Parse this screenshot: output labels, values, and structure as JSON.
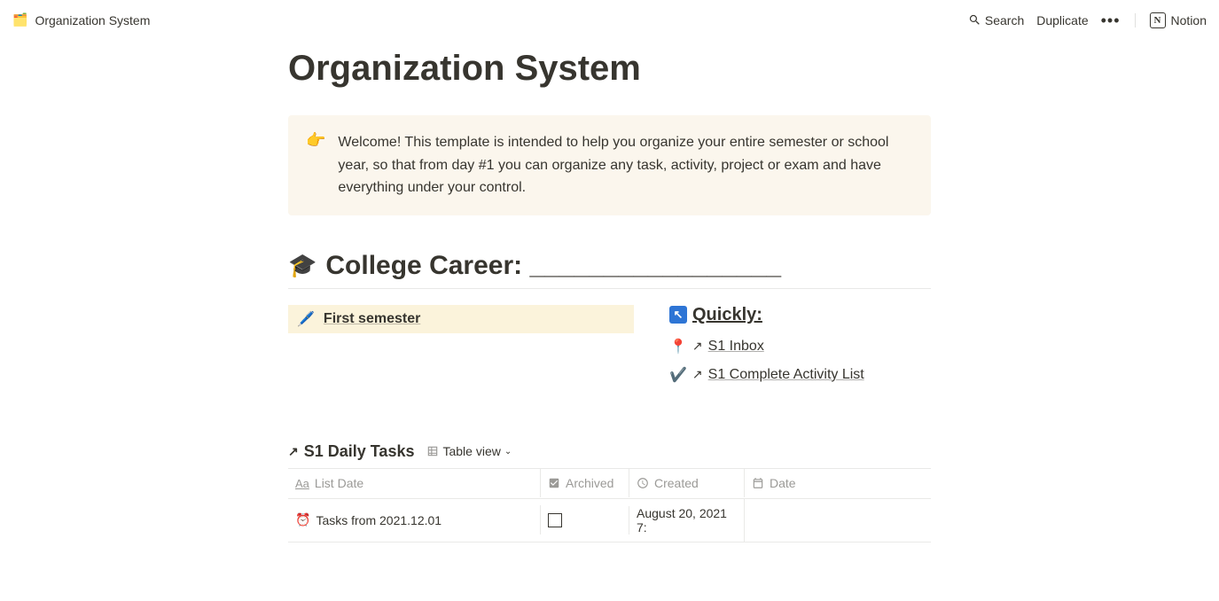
{
  "topbar": {
    "breadcrumb_icon": "🗂️",
    "breadcrumb_title": "Organization System",
    "search_label": "Search",
    "duplicate_label": "Duplicate",
    "notion_label": "Notion"
  },
  "page": {
    "title": "Organization System"
  },
  "callout": {
    "icon": "👉",
    "text": "Welcome! This template is intended to help you organize your entire semester or school year, so that from day #1 you can organize any task, activity, project or exam and have everything under your control."
  },
  "section": {
    "icon": "🎓",
    "heading": "College Career: _________________"
  },
  "semester": {
    "icon": "🖊️",
    "label": "First semester"
  },
  "quickly": {
    "heading": "Quickly:",
    "links": [
      {
        "icon": "📍",
        "label": "S1 Inbox"
      },
      {
        "icon": "✔️",
        "label": "S1 Complete Activity List"
      }
    ]
  },
  "database": {
    "title": "S1 Daily Tasks",
    "view_label": "Table view",
    "columns": {
      "list_date": "List Date",
      "archived": "Archived",
      "created": "Created",
      "date": "Date"
    },
    "rows": [
      {
        "icon": "⏰",
        "title": "Tasks from 2021.12.01",
        "archived": false,
        "created": "August 20, 2021 7:",
        "date": ""
      }
    ]
  }
}
